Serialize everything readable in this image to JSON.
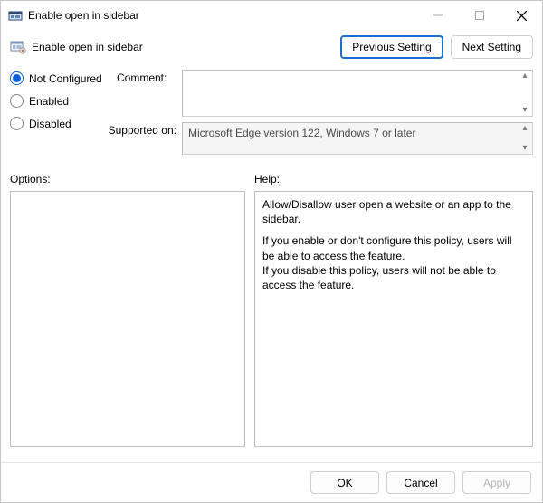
{
  "window": {
    "title": "Enable open in sidebar"
  },
  "subheader": {
    "title": "Enable open in sidebar"
  },
  "nav": {
    "previous": "Previous Setting",
    "next": "Next Setting"
  },
  "state": {
    "options": [
      {
        "label": "Not Configured",
        "selected": true
      },
      {
        "label": "Enabled",
        "selected": false
      },
      {
        "label": "Disabled",
        "selected": false
      }
    ]
  },
  "fields": {
    "comment_label": "Comment:",
    "comment_value": "",
    "supported_label": "Supported on:",
    "supported_value": "Microsoft Edge version 122, Windows 7 or later"
  },
  "panels": {
    "options_label": "Options:",
    "help_label": "Help:",
    "help_text_1": "Allow/Disallow user open a website or an app to the sidebar.",
    "help_text_2": "If you enable or don't configure this policy, users will be able to access the feature.",
    "help_text_3": "If you disable this policy, users will not be able to access the feature."
  },
  "footer": {
    "ok": "OK",
    "cancel": "Cancel",
    "apply": "Apply"
  }
}
